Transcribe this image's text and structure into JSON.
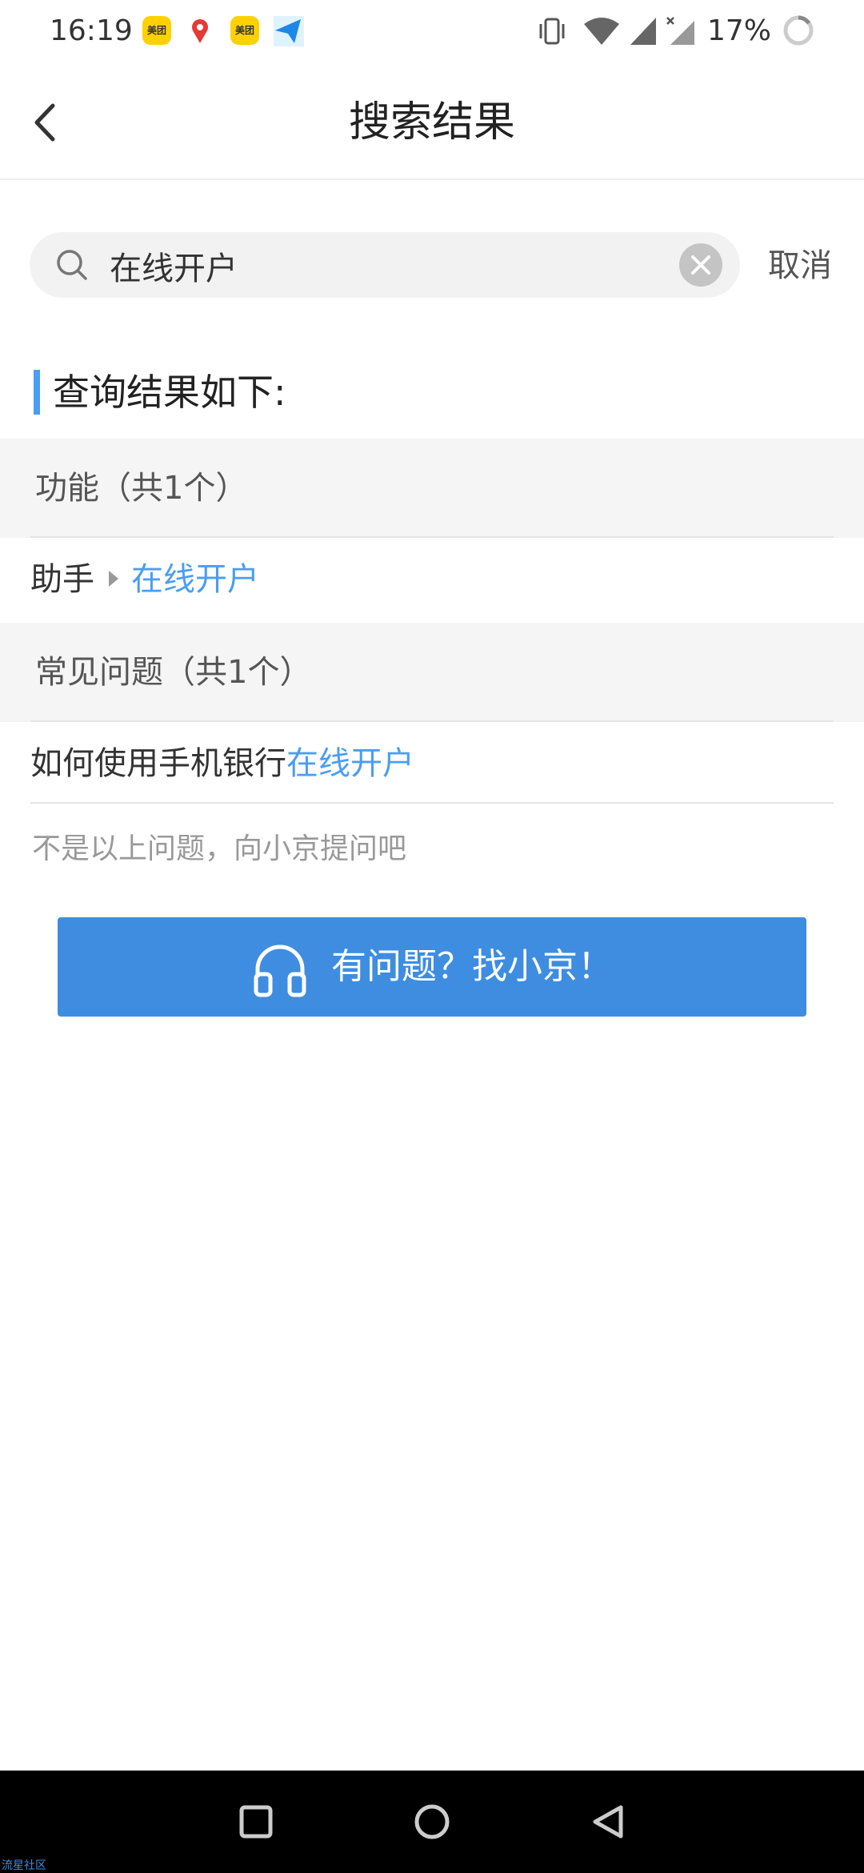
{
  "status_bar": {
    "time": "16:19",
    "notification_icons": [
      "meituan-icon",
      "map-pin-icon",
      "meituan-icon",
      "paper-plane-icon"
    ],
    "meituan_label": "美团",
    "battery": "17%"
  },
  "header": {
    "title": "搜索结果",
    "back_icon": "chevron-left-icon"
  },
  "search": {
    "value": "在线开户",
    "placeholder": "",
    "cancel_label": "取消"
  },
  "results": {
    "heading": "查询结果如下:",
    "functions_header": "功能（共1个）",
    "function_item": {
      "parent": "助手",
      "name": "在线开户"
    },
    "faq_header": "常见问题（共1个）",
    "faq_item": {
      "prefix": "如何使用手机银行",
      "highlight": "在线开户"
    },
    "ask_hint": "不是以上问题，向小京提问吧",
    "ask_button_label": "有问题？找小京！"
  },
  "footer": {
    "watermark": "流星社区"
  },
  "colors": {
    "accent": "#4a9ef2",
    "button": "#3e8de0",
    "band": "#f5f5f5"
  }
}
